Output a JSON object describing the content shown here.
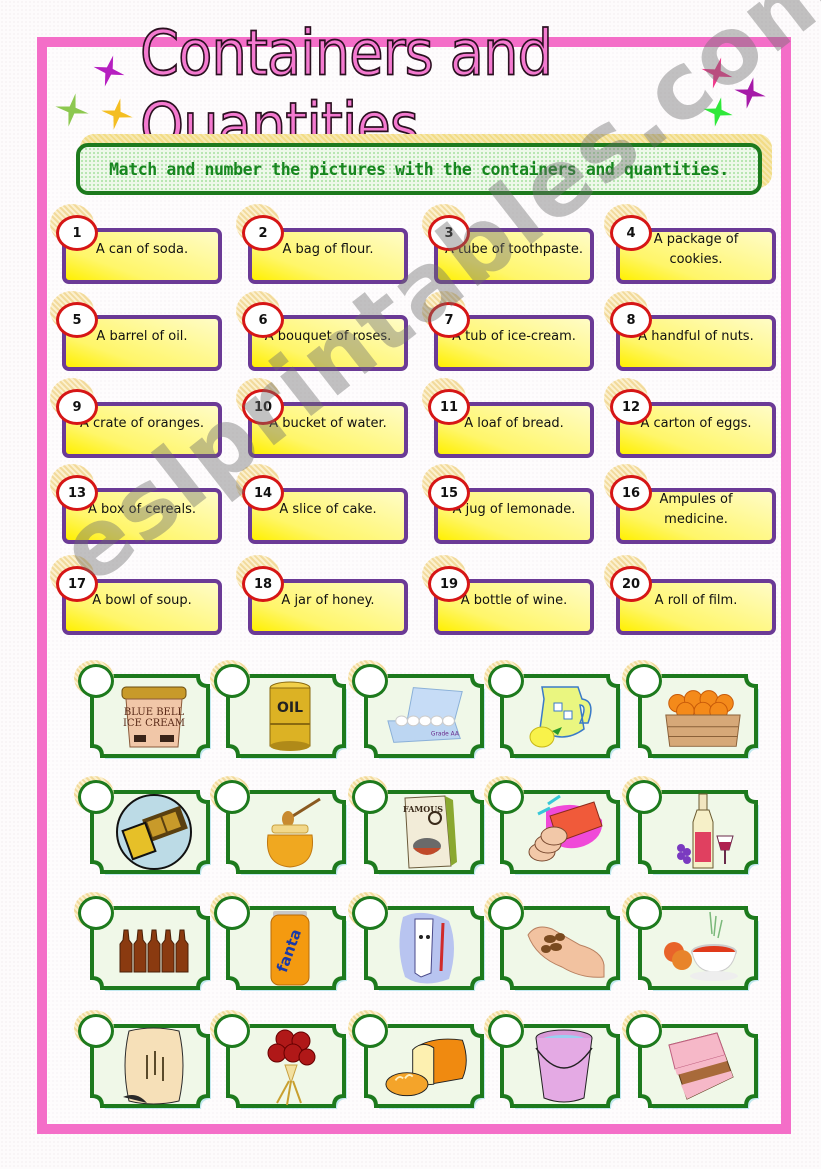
{
  "title": "Containers and Quantities",
  "instruction": "Match and number the pictures with the containers and quantities.",
  "watermark": "eslprintables.com",
  "colors": {
    "frame_border": "#f46ec8",
    "title_fill": "#f47ad0",
    "banner_border": "#1d7a1d",
    "banner_text": "#17861f",
    "card_border": "#6b3a96",
    "card_fill": "#fff66a",
    "number_ring": "#d61616",
    "tile_border": "#1d7a1d"
  },
  "phrases": [
    {
      "number": "1",
      "text": "A can of soda."
    },
    {
      "number": "2",
      "text": "A bag of flour."
    },
    {
      "number": "3",
      "text": "A tube of toothpaste."
    },
    {
      "number": "4",
      "text": "A package of cookies."
    },
    {
      "number": "5",
      "text": "A barrel of oil."
    },
    {
      "number": "6",
      "text": "A bouquet of roses."
    },
    {
      "number": "7",
      "text": "A tub of ice-cream."
    },
    {
      "number": "8",
      "text": "A handful of nuts."
    },
    {
      "number": "9",
      "text": "A crate of oranges."
    },
    {
      "number": "10",
      "text": "A bucket of water."
    },
    {
      "number": "11",
      "text": "A loaf of bread."
    },
    {
      "number": "12",
      "text": "A carton of eggs."
    },
    {
      "number": "13",
      "text": "A box of cereals."
    },
    {
      "number": "14",
      "text": "A slice of cake."
    },
    {
      "number": "15",
      "text": "A jug of lemonade."
    },
    {
      "number": "16",
      "text": "Ampules of medicine."
    },
    {
      "number": "17",
      "text": "A bowl of soup."
    },
    {
      "number": "18",
      "text": "A jar of honey."
    },
    {
      "number": "19",
      "text": "A bottle of wine."
    },
    {
      "number": "20",
      "text": "A roll of film."
    }
  ],
  "pictures": [
    {
      "icon": "ice-cream-tub-icon",
      "label": "ice cream tub",
      "answer": ""
    },
    {
      "icon": "oil-barrel-icon",
      "label": "oil barrel",
      "answer": ""
    },
    {
      "icon": "egg-carton-icon",
      "label": "egg carton",
      "answer": ""
    },
    {
      "icon": "lemonade-jug-icon",
      "label": "lemonade jug",
      "answer": ""
    },
    {
      "icon": "orange-crate-icon",
      "label": "crate of oranges",
      "answer": ""
    },
    {
      "icon": "film-roll-icon",
      "label": "film roll",
      "answer": ""
    },
    {
      "icon": "honey-jar-icon",
      "label": "honey jar",
      "answer": ""
    },
    {
      "icon": "cereal-box-icon",
      "label": "cereal box",
      "answer": ""
    },
    {
      "icon": "cookie-package-icon",
      "label": "cookie package",
      "answer": ""
    },
    {
      "icon": "wine-bottle-icon",
      "label": "wine bottle",
      "answer": ""
    },
    {
      "icon": "ampules-icon",
      "label": "ampules",
      "answer": ""
    },
    {
      "icon": "soda-can-icon",
      "label": "soda can",
      "answer": ""
    },
    {
      "icon": "toothpaste-tube-icon",
      "label": "toothpaste tube",
      "answer": ""
    },
    {
      "icon": "handful-of-nuts-icon",
      "label": "handful of nuts",
      "answer": ""
    },
    {
      "icon": "soup-bowl-icon",
      "label": "bowl of soup",
      "answer": ""
    },
    {
      "icon": "flour-bag-icon",
      "label": "bag of flour",
      "answer": ""
    },
    {
      "icon": "rose-bouquet-icon",
      "label": "bouquet of roses",
      "answer": ""
    },
    {
      "icon": "bread-loaf-icon",
      "label": "loaf of bread",
      "answer": ""
    },
    {
      "icon": "water-bucket-icon",
      "label": "bucket of water",
      "answer": ""
    },
    {
      "icon": "cake-slice-icon",
      "label": "slice of cake",
      "answer": ""
    }
  ]
}
